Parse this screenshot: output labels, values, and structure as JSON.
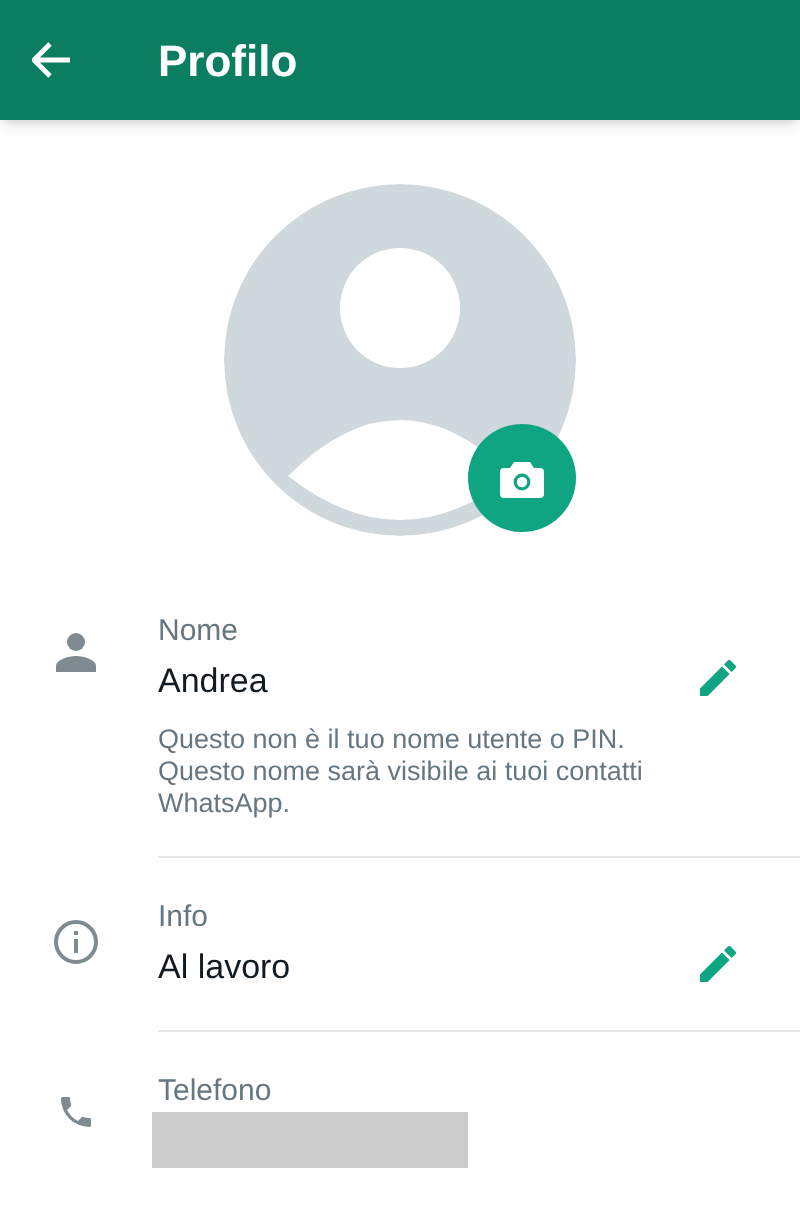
{
  "app_bar": {
    "title": "Profilo"
  },
  "fields": [
    {
      "kind": "person",
      "label": "Nome",
      "value": "Andrea",
      "editable": true,
      "hint": "Questo non è il tuo nome utente o PIN. Questo nome sarà visibile ai tuoi contatti WhatsApp."
    },
    {
      "kind": "info",
      "label": "Info",
      "value": "Al lavoro",
      "editable": true
    },
    {
      "kind": "phone",
      "label": "Telefono",
      "redacted": true
    }
  ]
}
